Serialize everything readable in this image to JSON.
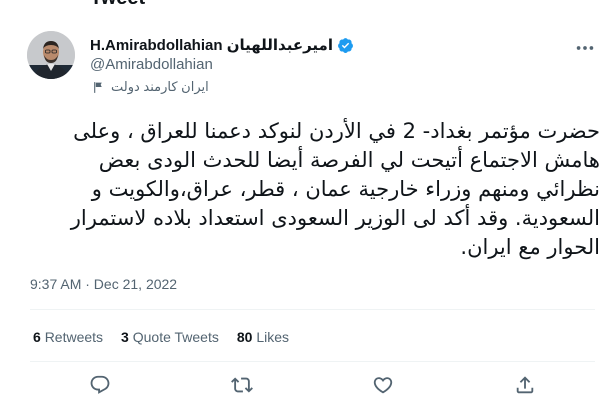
{
  "header": {
    "title": "Tweet"
  },
  "author": {
    "display_name": "H.Amirabdollahian امیرعبداللهیان",
    "handle": "@Amirabdollahian",
    "label": "ایران کارمند دولت"
  },
  "tweet": {
    "text": "حضرت مؤتمر بغداد- 2 في الأردن لنوكد دعمنا للعراق ، وعلى هامش الاجتماع أتيحت لي الفرصة أيضا للحدث الودى بعض نظرائي ومنهم وزراء خارجية عمان ، قطر، عراق،والكويت و السعودية. وقد أكد لى الوزير السعودى استعداد بلاده لاستمرار الحوار مع ايران.",
    "timestamp": "9:37 AM · Dec 21, 2022"
  },
  "stats": {
    "retweets_count": "6",
    "retweets_label": "Retweets",
    "quotes_count": "3",
    "quotes_label": "Quote Tweets",
    "likes_count": "80",
    "likes_label": "Likes"
  },
  "icons": {
    "verified": "verified-badge-icon",
    "more": "more-options-icon",
    "label": "government-flag-icon",
    "reply": "reply-icon",
    "retweet": "retweet-icon",
    "like": "like-icon",
    "share": "share-icon"
  },
  "colors": {
    "verified": "#1d9bf0",
    "secondary_text": "#536471",
    "divider": "#eff3f4"
  }
}
